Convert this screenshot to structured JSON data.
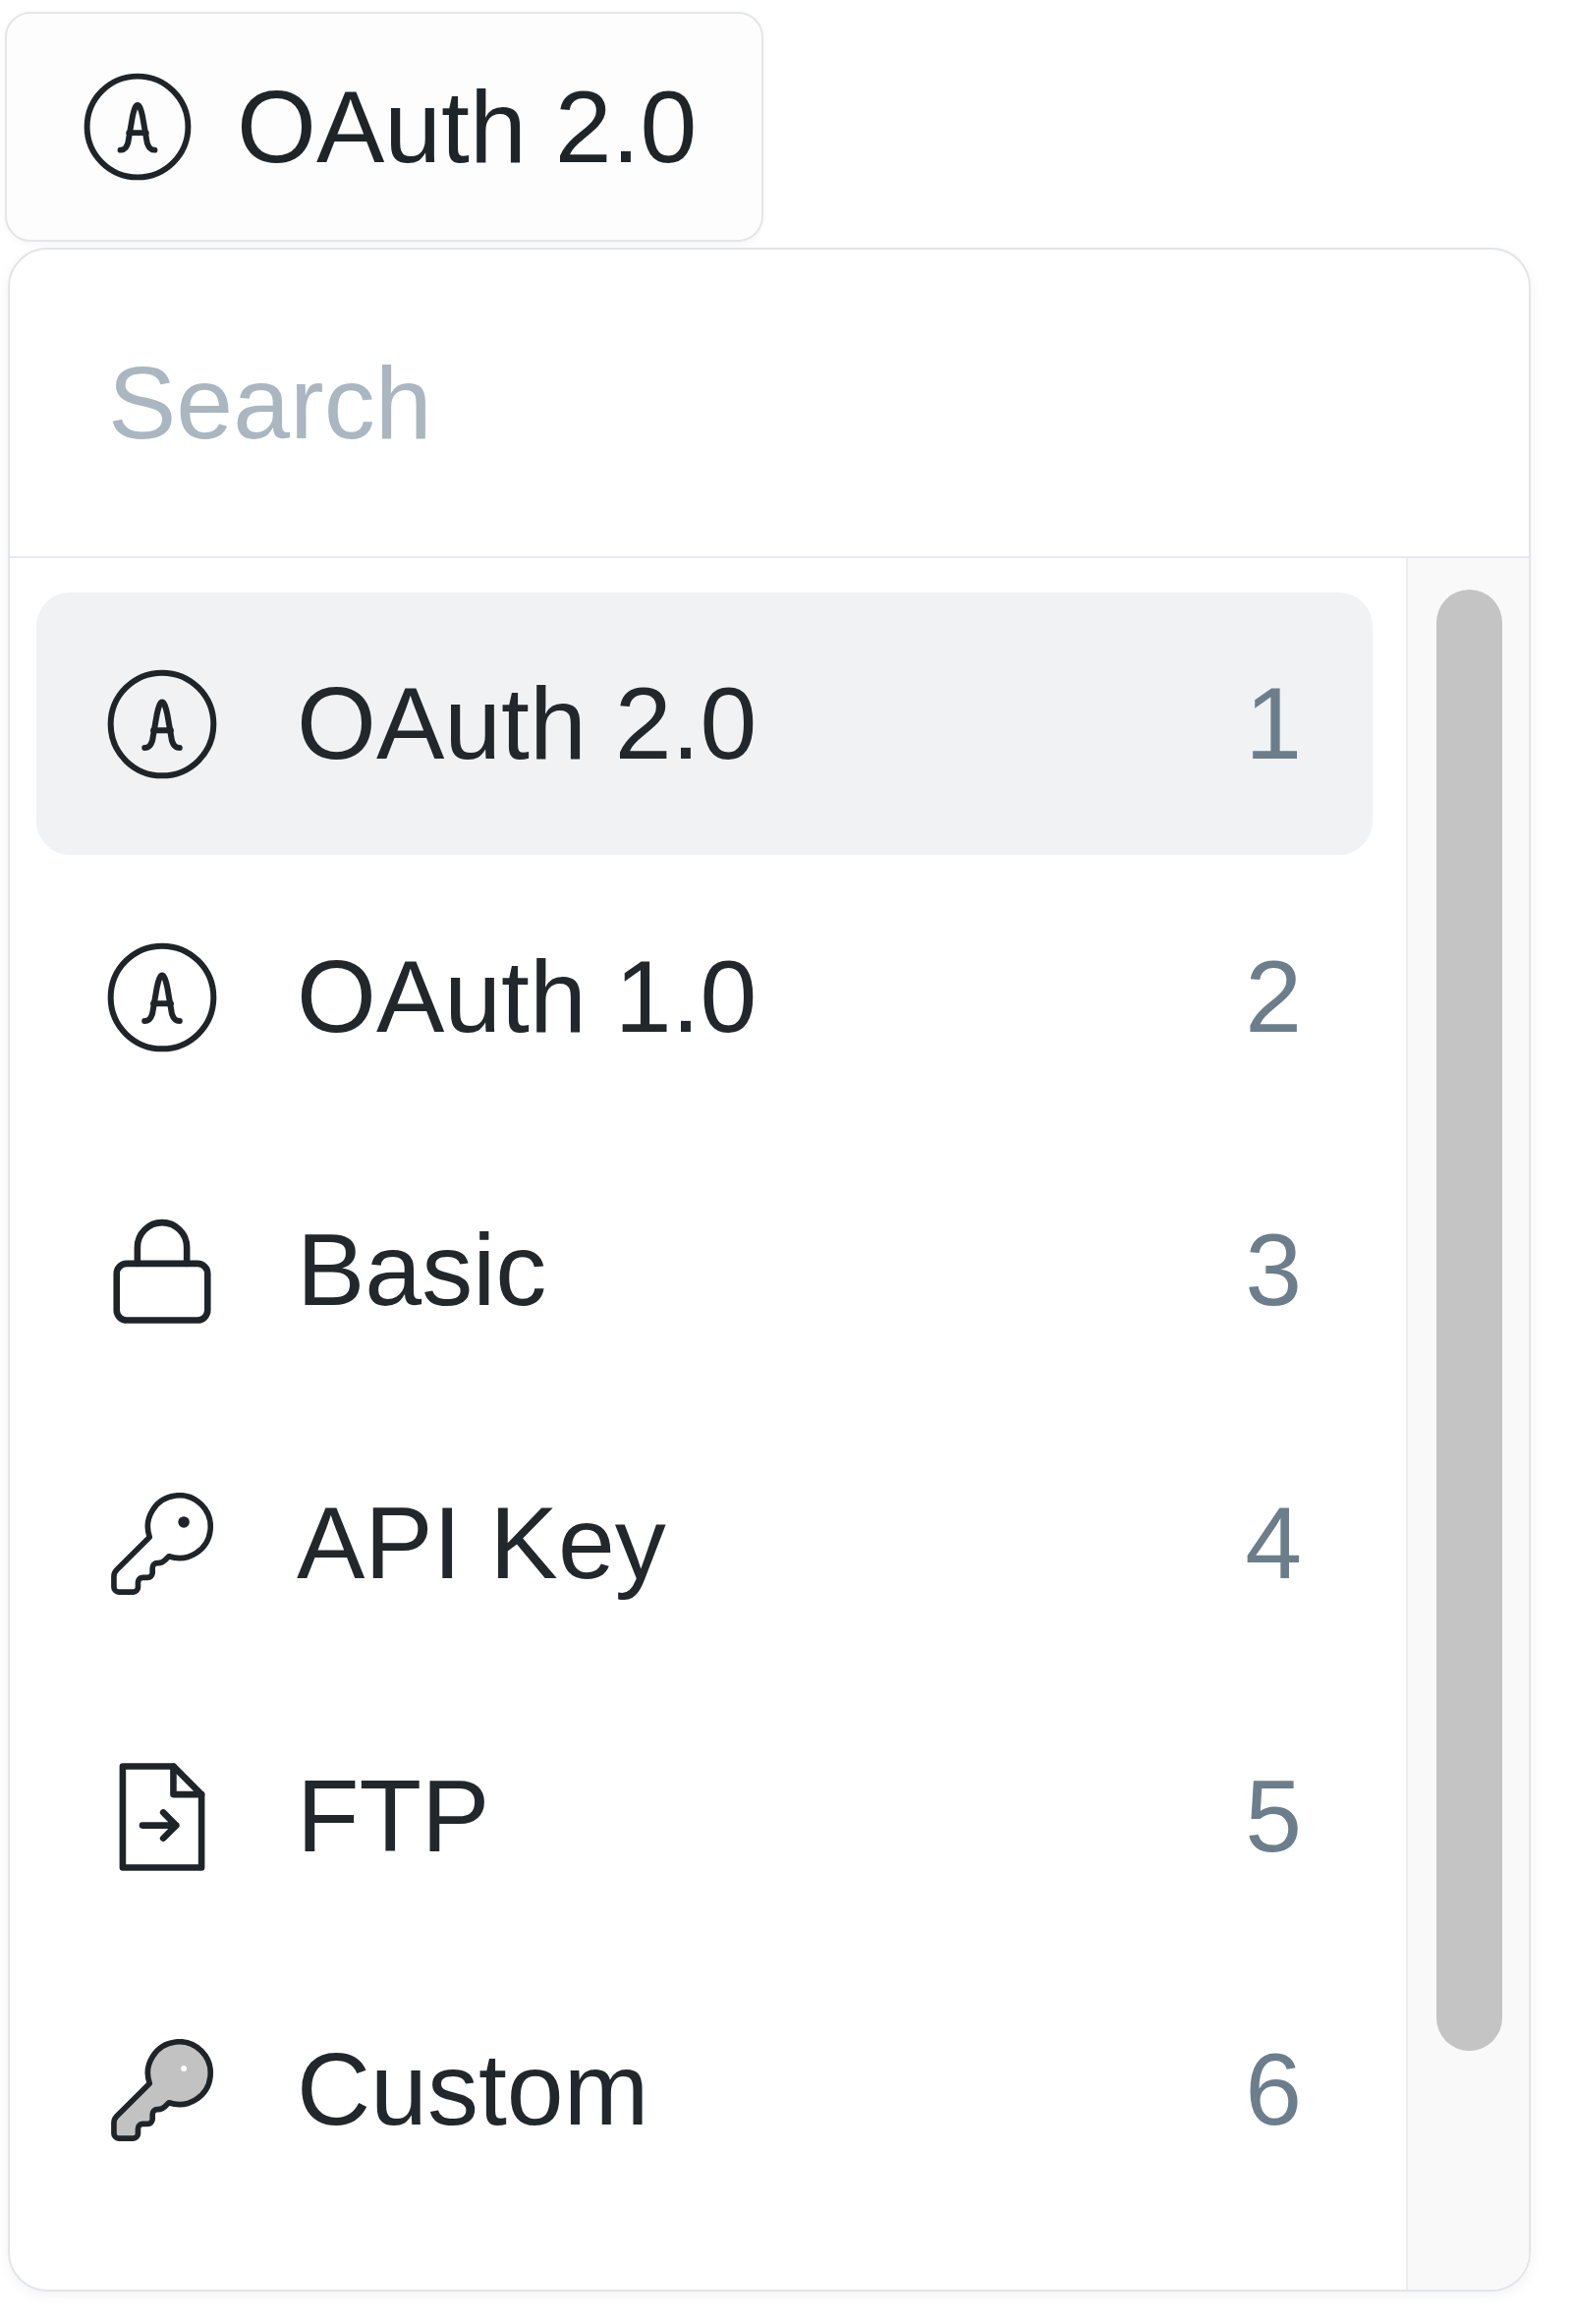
{
  "trigger": {
    "label": "OAuth 2.0",
    "kind": "oauth"
  },
  "menu": {
    "search": {
      "placeholder": "Search"
    },
    "items": [
      {
        "label": "OAuth 2.0",
        "shortcut": "1",
        "kind": "oauth",
        "selected": true
      },
      {
        "label": "OAuth 1.0",
        "shortcut": "2",
        "kind": "oauth",
        "selected": false
      },
      {
        "label": "Basic",
        "shortcut": "3",
        "kind": "lock",
        "selected": false
      },
      {
        "label": "API Key",
        "shortcut": "4",
        "kind": "key",
        "selected": false
      },
      {
        "label": "FTP",
        "shortcut": "5",
        "kind": "file",
        "selected": false
      },
      {
        "label": "Custom",
        "shortcut": "6",
        "kind": "solidkey",
        "selected": false
      }
    ]
  }
}
